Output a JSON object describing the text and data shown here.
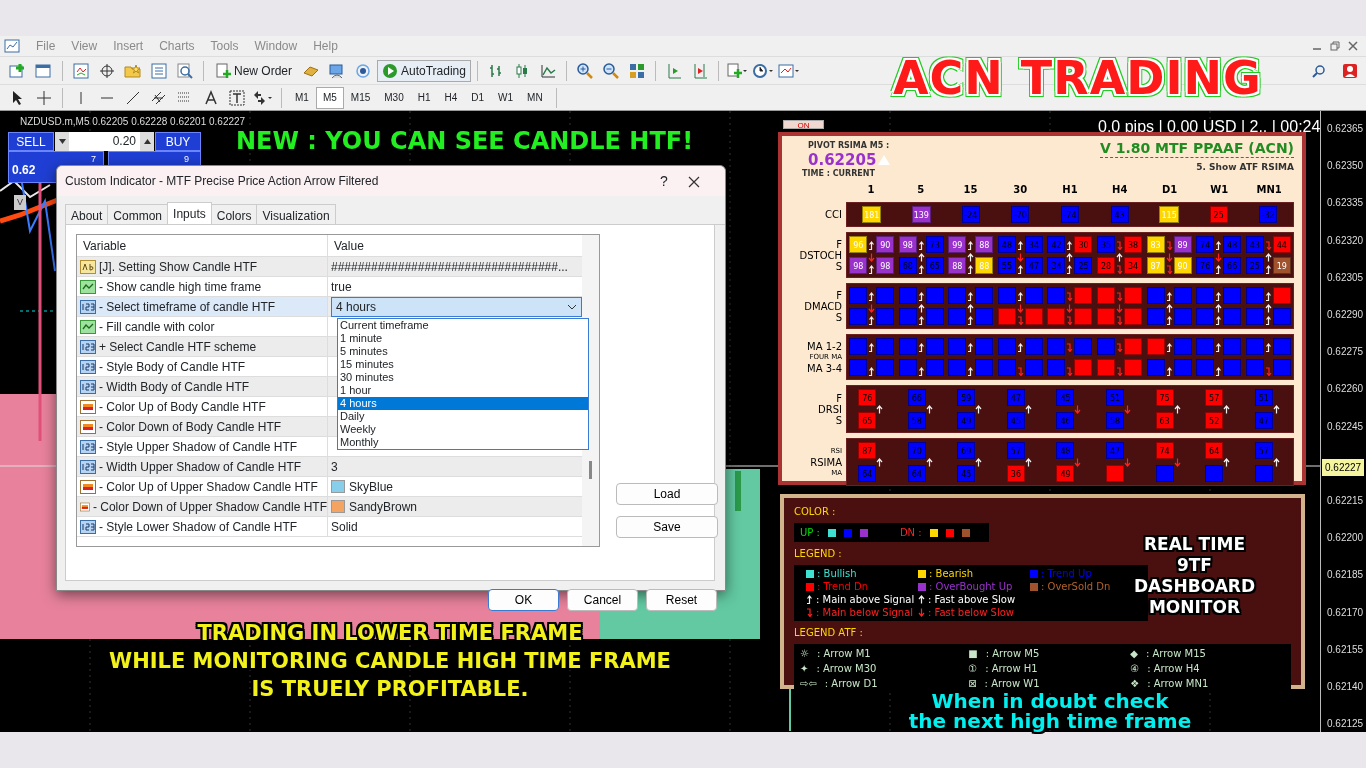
{
  "menu": [
    {
      "label": "File"
    },
    {
      "label": "View"
    },
    {
      "label": "Insert"
    },
    {
      "label": "Charts"
    },
    {
      "label": "Tools"
    },
    {
      "label": "Window"
    },
    {
      "label": "Help"
    }
  ],
  "toolbar": {
    "new_order": "New Order",
    "auto_trading": "AutoTrading"
  },
  "timeframes": [
    {
      "label": "M1",
      "selected": false
    },
    {
      "label": "M5",
      "selected": true
    },
    {
      "label": "M15",
      "selected": false
    },
    {
      "label": "M30",
      "selected": false
    },
    {
      "label": "H1",
      "selected": false
    },
    {
      "label": "H4",
      "selected": false
    },
    {
      "label": "D1",
      "selected": false
    },
    {
      "label": "W1",
      "selected": false
    },
    {
      "label": "MN",
      "selected": false
    }
  ],
  "logo": "ACN TRADING",
  "chart": {
    "symbol": "NZDUSD.m,M5  0.62205 0.62228 0.62201 0.62227",
    "on_button": "ON",
    "status": "0.0 pips | 0.00 USD | 2.. | 00:24",
    "current_price": "0.62227",
    "price_axis": [
      "0.62365",
      "0.62350",
      "0.62335",
      "0.62320",
      "0.62305",
      "0.62290",
      "0.62275",
      "0.62260",
      "0.62245",
      "0.62215",
      "0.62200",
      "0.62185",
      "0.62170",
      "0.62155",
      "0.62140",
      "0.62125"
    ]
  },
  "trade_panel": {
    "sell": "SELL",
    "lot": "0.20",
    "buy": "BUY",
    "sell_price": "0.62",
    "sell_digit": "7",
    "buy_digit": "9",
    "marker": "V"
  },
  "banners": [
    {
      "lines": [
        "NEW : YOU CAN SEE CANDLE HTF!"
      ],
      "color": "#22ee22"
    },
    {
      "lines": [
        "TRADING IN LOWER TIME FRAME",
        "WHILE MONITORING CANDLE HIGH TIME FRAME",
        "IS TRUELY PROFITABLE."
      ],
      "color": "#f2f21a"
    },
    {
      "lines": [
        "When in doubt check",
        "the next high time frame"
      ],
      "color": "#00f0f0"
    }
  ],
  "dialog": {
    "title": "Custom Indicator - MTF Precise Price Action Arrow Filtered",
    "help": "?",
    "tabs": [
      {
        "label": "About",
        "selected": false
      },
      {
        "label": "Common",
        "selected": false
      },
      {
        "label": "Inputs",
        "selected": true
      },
      {
        "label": "Colors",
        "selected": false
      },
      {
        "label": "Visualization",
        "selected": false
      }
    ],
    "columns": [
      "Variable",
      "Value"
    ],
    "rows": [
      {
        "kind": "string",
        "name": "[J]. Setting Show Candle HTF",
        "value": "##################################...",
        "selected": false
      },
      {
        "kind": "bool",
        "name": "- Show candle high time frame",
        "value": "true",
        "selected": false
      },
      {
        "kind": "int",
        "name": "- Select timeframe of candle HTF",
        "value": "4 hours",
        "selected": true
      },
      {
        "kind": "bool",
        "name": "- Fill candle with color",
        "selected": false
      },
      {
        "kind": "int",
        "name": "+ Select Candle HTF scheme",
        "selected": false
      },
      {
        "kind": "int",
        "name": "- Style Body of Candle HTF",
        "selected": false
      },
      {
        "kind": "int",
        "name": "- Width Body of Candle HTF",
        "selected": false
      },
      {
        "kind": "color",
        "name": "- Color Up of Body Candle HTF",
        "selected": false
      },
      {
        "kind": "color",
        "name": "- Color Down of Body Candle HTF",
        "selected": false
      },
      {
        "kind": "int",
        "name": "- Style Upper Shadow of Candle HTF",
        "selected": false
      },
      {
        "kind": "int",
        "name": "- Width Upper Shadow of Candle HTF",
        "value": "3",
        "selected": false
      },
      {
        "kind": "color",
        "name": "- Color Up of Upper Shadow Candle HTF",
        "value": "SkyBlue",
        "color": "#87ceeb",
        "selected": false
      },
      {
        "kind": "color",
        "name": "- Color Down of Upper Shadow Candle HTF",
        "value": "SandyBrown",
        "color": "#f4a460",
        "selected": false
      },
      {
        "kind": "int",
        "name": "- Style Lower Shadow of Candle HTF",
        "value": "Solid",
        "selected": false
      }
    ],
    "options": [
      {
        "label": "Current timeframe",
        "selected": false
      },
      {
        "label": "1 minute",
        "selected": false
      },
      {
        "label": "5 minutes",
        "selected": false
      },
      {
        "label": "15 minutes",
        "selected": false
      },
      {
        "label": "30 minutes",
        "selected": false
      },
      {
        "label": "1 hour",
        "selected": false
      },
      {
        "label": "4 hours",
        "selected": true
      },
      {
        "label": "Daily",
        "selected": false
      },
      {
        "label": "Weekly",
        "selected": false
      },
      {
        "label": "Monthly",
        "selected": false
      }
    ],
    "side_buttons": [
      "Load",
      "Save"
    ],
    "buttons": [
      "OK",
      "Cancel",
      "Reset"
    ]
  },
  "dashboard": {
    "pivot_label": "PIVOT RSIMA M5 :",
    "pivot_value": "0.62205",
    "pivot_rising": true,
    "time_label": "TIME : CURRENT",
    "title": "V 1.80 MTF PPAAF (ACN)",
    "subtitle": "5. Show ATF RSIMA",
    "timeframes": [
      "1",
      "5",
      "15",
      "30",
      "H1",
      "H4",
      "D1",
      "W1",
      "MN1"
    ],
    "rows": [
      {
        "kind": "single",
        "labels": [
          "CCI"
        ],
        "cells": [
          {
            "v": "181",
            "color": "#ffd700"
          },
          {
            "v": "139",
            "color": "#9932cc"
          },
          {
            "v": "-24",
            "color": "#0000ff"
          },
          {
            "v": "-70",
            "color": "#0000ff"
          },
          {
            "v": "-74",
            "color": "#0000ff"
          },
          {
            "v": "43",
            "color": "#0000ff"
          },
          {
            "v": "115",
            "color": "#ffd700"
          },
          {
            "v": "25",
            "color": "#ff0000"
          },
          {
            "v": "-32",
            "color": "#0000ff"
          }
        ]
      },
      {
        "kind": "pair",
        "labels": [
          "F",
          "DSTOCH",
          "S"
        ],
        "groups": [
          {
            "f": [
              {
                "v": "96",
                "color": "#ffd700"
              },
              {
                "v": "90",
                "color": "#9932cc"
              }
            ],
            "s": [
              {
                "v": "98",
                "color": "#9932cc"
              },
              {
                "v": "98",
                "color": "#9932cc"
              }
            ],
            "f_above": true,
            "s_above": true,
            "rising": false
          },
          {
            "f": [
              {
                "v": "98",
                "color": "#9932cc"
              },
              {
                "v": "73",
                "color": "#0000ff"
              }
            ],
            "s": [
              {
                "v": "68",
                "color": "#0000ff"
              },
              {
                "v": "65",
                "color": "#0000ff"
              }
            ],
            "f_above": true,
            "s_above": true,
            "rising": true
          },
          {
            "f": [
              {
                "v": "99",
                "color": "#9932cc"
              },
              {
                "v": "88",
                "color": "#9932cc"
              }
            ],
            "s": [
              {
                "v": "88",
                "color": "#9932cc"
              },
              {
                "v": "88",
                "color": "#ffd700"
              }
            ],
            "f_above": true,
            "s_above": true,
            "rising": true
          },
          {
            "f": [
              {
                "v": "48",
                "color": "#0000ff"
              },
              {
                "v": "34",
                "color": "#0000ff"
              }
            ],
            "s": [
              {
                "v": "55",
                "color": "#0000ff"
              },
              {
                "v": "47",
                "color": "#0000ff"
              }
            ],
            "f_above": true,
            "s_above": true,
            "rising": false
          },
          {
            "f": [
              {
                "v": "42",
                "color": "#0000ff"
              },
              {
                "v": "30",
                "color": "#ff0000"
              }
            ],
            "s": [
              {
                "v": "34",
                "color": "#0000ff"
              },
              {
                "v": "25",
                "color": "#0000ff"
              }
            ],
            "f_above": true,
            "s_above": true,
            "rising": true
          },
          {
            "f": [
              {
                "v": "35",
                "color": "#0000ff"
              },
              {
                "v": "38",
                "color": "#ff0000"
              }
            ],
            "s": [
              {
                "v": "28",
                "color": "#ff0000"
              },
              {
                "v": "34",
                "color": "#ff0000"
              }
            ],
            "f_above": false,
            "s_above": false,
            "rising": true
          },
          {
            "f": [
              {
                "v": "83",
                "color": "#ffd700"
              },
              {
                "v": "89",
                "color": "#9932cc"
              }
            ],
            "s": [
              {
                "v": "87",
                "color": "#ffd700"
              },
              {
                "v": "90",
                "color": "#ffd700"
              }
            ],
            "f_above": false,
            "s_above": false,
            "rising": false
          },
          {
            "f": [
              {
                "v": "74",
                "color": "#0000ff"
              },
              {
                "v": "48",
                "color": "#0000ff"
              }
            ],
            "s": [
              {
                "v": "76",
                "color": "#0000ff"
              },
              {
                "v": "66",
                "color": "#0000ff"
              }
            ],
            "f_above": true,
            "s_above": true,
            "rising": false
          },
          {
            "f": [
              {
                "v": "43",
                "color": "#0000ff"
              },
              {
                "v": "44",
                "color": "#ff0000"
              }
            ],
            "s": [
              {
                "v": "25",
                "color": "#0000ff"
              },
              {
                "v": "19",
                "color": "#a0522d"
              }
            ],
            "f_above": false,
            "s_above": true,
            "rising": true
          }
        ]
      },
      {
        "kind": "pair",
        "labels": [
          "F",
          "DMACD",
          "S"
        ],
        "groups": [
          {
            "f": [
              {
                "color": "#0000ff"
              },
              {
                "color": "#0000ff"
              }
            ],
            "s": [
              {
                "color": "#0000ff"
              },
              {
                "color": "#0000ff"
              }
            ],
            "f_above": true,
            "s_above": true,
            "rising": false
          },
          {
            "f": [
              {
                "color": "#0000ff"
              },
              {
                "color": "#0000ff"
              }
            ],
            "s": [
              {
                "color": "#0000ff"
              },
              {
                "color": "#0000ff"
              }
            ],
            "f_above": true,
            "s_above": true,
            "rising": true
          },
          {
            "f": [
              {
                "color": "#0000ff"
              },
              {
                "color": "#0000ff"
              }
            ],
            "s": [
              {
                "color": "#0000ff"
              },
              {
                "color": "#0000ff"
              }
            ],
            "f_above": true,
            "s_above": true,
            "rising": true
          },
          {
            "f": [
              {
                "color": "#0000ff"
              },
              {
                "color": "#0000ff"
              }
            ],
            "s": [
              {
                "color": "#ff0000"
              },
              {
                "color": "#ff0000"
              }
            ],
            "f_above": true,
            "s_above": false,
            "rising": false
          },
          {
            "f": [
              {
                "color": "#0000ff"
              },
              {
                "color": "#ff0000"
              }
            ],
            "s": [
              {
                "color": "#ff0000"
              },
              {
                "color": "#ff0000"
              }
            ],
            "f_above": false,
            "s_above": false,
            "rising": false
          },
          {
            "f": [
              {
                "color": "#ff0000"
              },
              {
                "color": "#ff0000"
              }
            ],
            "s": [
              {
                "color": "#ff0000"
              },
              {
                "color": "#ff0000"
              }
            ],
            "f_above": false,
            "s_above": false,
            "rising": false
          },
          {
            "f": [
              {
                "color": "#0000ff"
              },
              {
                "color": "#0000ff"
              }
            ],
            "s": [
              {
                "color": "#0000ff"
              },
              {
                "color": "#0000ff"
              }
            ],
            "f_above": true,
            "s_above": true,
            "rising": true
          },
          {
            "f": [
              {
                "color": "#0000ff"
              },
              {
                "color": "#0000ff"
              }
            ],
            "s": [
              {
                "color": "#0000ff"
              },
              {
                "color": "#0000ff"
              }
            ],
            "f_above": true,
            "s_above": true,
            "rising": true
          },
          {
            "f": [
              {
                "color": "#0000ff"
              },
              {
                "color": "#ff0000"
              }
            ],
            "s": [
              {
                "color": "#0000ff"
              },
              {
                "color": "#0000ff"
              }
            ],
            "f_above": true,
            "s_above": true,
            "rising": true
          }
        ]
      },
      {
        "kind": "pair",
        "labels": [
          "MA 1-2",
          "FOUR MA",
          "MA 3-4"
        ],
        "groups": [
          {
            "f": [
              {
                "color": "#0000ff"
              },
              {
                "color": "#0000ff"
              }
            ],
            "s": [
              {
                "color": "#0000ff"
              },
              {
                "color": "#0000ff"
              }
            ],
            "f_above": true,
            "s_above": true
          },
          {
            "f": [
              {
                "color": "#0000ff"
              },
              {
                "color": "#0000ff"
              }
            ],
            "s": [
              {
                "color": "#0000ff"
              },
              {
                "color": "#0000ff"
              }
            ],
            "f_above": true,
            "s_above": true
          },
          {
            "f": [
              {
                "color": "#0000ff"
              },
              {
                "color": "#0000ff"
              }
            ],
            "s": [
              {
                "color": "#0000ff"
              },
              {
                "color": "#0000ff"
              }
            ],
            "f_above": true,
            "s_above": true
          },
          {
            "f": [
              {
                "color": "#0000ff"
              },
              {
                "color": "#0000ff"
              }
            ],
            "s": [
              {
                "color": "#0000ff"
              },
              {
                "color": "#0000ff"
              }
            ],
            "f_above": true,
            "s_above": false
          },
          {
            "f": [
              {
                "color": "#0000ff"
              },
              {
                "color": "#0000ff"
              }
            ],
            "s": [
              {
                "color": "#0000ff"
              },
              {
                "color": "#ff0000"
              }
            ],
            "f_above": false,
            "s_above": false
          },
          {
            "f": [
              {
                "color": "#0000ff"
              },
              {
                "color": "#ff0000"
              }
            ],
            "s": [
              {
                "color": "#ff0000"
              },
              {
                "color": "#ff0000"
              }
            ],
            "f_above": false,
            "s_above": false
          },
          {
            "f": [
              {
                "color": "#ff0000"
              },
              {
                "color": "#0000ff"
              }
            ],
            "s": [
              {
                "color": "#0000ff"
              },
              {
                "color": "#0000ff"
              }
            ],
            "f_above": true,
            "s_above": true
          },
          {
            "f": [
              {
                "color": "#0000ff"
              },
              {
                "color": "#0000ff"
              }
            ],
            "s": [
              {
                "color": "#0000ff"
              },
              {
                "color": "#0000ff"
              }
            ],
            "f_above": true,
            "s_above": true
          },
          {
            "f": [
              {
                "color": "#0000ff"
              },
              {
                "color": "#0000ff"
              }
            ],
            "s": [
              {
                "color": "#0000ff"
              },
              {
                "color": "#0000ff"
              }
            ],
            "f_above": true,
            "s_above": false
          }
        ]
      },
      {
        "kind": "stack",
        "labels": [
          "F",
          "DRSI",
          "S"
        ],
        "groups": [
          {
            "top": {
              "v": "76",
              "color": "#ff0000"
            },
            "bottom": {
              "v": "65",
              "color": "#ff0000"
            },
            "rising": true
          },
          {
            "top": {
              "v": "66",
              "color": "#0000ff"
            },
            "bottom": {
              "v": "58",
              "color": "#0000ff"
            },
            "rising": true
          },
          {
            "top": {
              "v": "59",
              "color": "#0000ff"
            },
            "bottom": {
              "v": "49",
              "color": "#0000ff"
            },
            "rising": true
          },
          {
            "top": {
              "v": "47",
              "color": "#0000ff"
            },
            "bottom": {
              "v": "45",
              "color": "#0000ff"
            },
            "rising": true
          },
          {
            "top": {
              "v": "45",
              "color": "#0000ff"
            },
            "bottom": {
              "v": "46",
              "color": "#0000ff"
            },
            "rising": false
          },
          {
            "top": {
              "v": "51",
              "color": "#0000ff"
            },
            "bottom": {
              "v": "58",
              "color": "#0000ff"
            },
            "rising": false
          },
          {
            "top": {
              "v": "75",
              "color": "#ff0000"
            },
            "bottom": {
              "v": "63",
              "color": "#ff0000"
            },
            "rising": true
          },
          {
            "top": {
              "v": "57",
              "color": "#ff0000"
            },
            "bottom": {
              "v": "52",
              "color": "#ff0000"
            },
            "rising": true
          },
          {
            "top": {
              "v": "51",
              "color": "#0000ff"
            },
            "bottom": {
              "v": "47",
              "color": "#0000ff"
            },
            "rising": true
          }
        ]
      },
      {
        "kind": "stack",
        "labels": [
          "RSI",
          "RSIMA",
          "MA"
        ],
        "groups": [
          {
            "top": {
              "v": "87",
              "color": "#ff0000"
            },
            "bottom": {
              "v": "64",
              "color": "#0000ff"
            },
            "rising": true
          },
          {
            "top": {
              "v": "70",
              "color": "#0000ff"
            },
            "bottom": {
              "v": "64",
              "color": "#0000ff"
            },
            "rising": true
          },
          {
            "top": {
              "v": "69",
              "color": "#0000ff"
            },
            "bottom": {
              "v": "45",
              "color": "#0000ff"
            },
            "rising": true
          },
          {
            "top": {
              "v": "57",
              "color": "#0000ff"
            },
            "bottom": {
              "v": "36",
              "color": "#ff0000"
            },
            "rising": true
          },
          {
            "top": {
              "v": "48",
              "color": "#0000ff"
            },
            "bottom": {
              "v": "49",
              "color": "#ff0000"
            },
            "rising": false
          },
          {
            "top": {
              "v": "47",
              "color": "#0000ff"
            },
            "bottom": {
              "color": "#ff0000"
            },
            "rising": false
          },
          {
            "top": {
              "v": "74",
              "color": "#ff0000"
            },
            "bottom": {
              "color": "#0000ff"
            },
            "rising": false
          },
          {
            "top": {
              "v": "64",
              "color": "#ff0000"
            },
            "bottom": {
              "color": "#0000ff"
            },
            "rising": true
          },
          {
            "top": {
              "v": "57",
              "color": "#0000ff"
            },
            "bottom": {
              "color": "#0000ff"
            },
            "rising": true
          }
        ]
      }
    ]
  },
  "legend": {
    "color_title": "COLOR :",
    "up_label": "UP :",
    "up_colors": [
      {
        "color": "#40e0d0"
      },
      {
        "color": "#0000ff"
      },
      {
        "color": "#9932cc"
      }
    ],
    "dn_label": "DN :",
    "dn_colors": [
      {
        "color": "#ffd700"
      },
      {
        "color": "#ff0000"
      },
      {
        "color": "#a0522d"
      }
    ],
    "legend_title": "LEGEND :",
    "items": [
      {
        "kind": "swatch",
        "color": "#40e0d0",
        "text": ": Bullish"
      },
      {
        "kind": "swatch",
        "color": "#ffd700",
        "text": ": Bearish"
      },
      {
        "kind": "swatch",
        "color": "#0000ff",
        "text": ": Trend Up"
      },
      {
        "kind": "swatch",
        "color": "#ff0000",
        "text": ": Trend Dn"
      },
      {
        "kind": "swatch",
        "color": "#9932cc",
        "text": ": OverBought Up"
      },
      {
        "kind": "swatch",
        "color": "#a0522d",
        "text": ": OverSold Dn"
      },
      {
        "kind": "hook_up",
        "text": ": Main above Signal"
      },
      {
        "kind": "arrow_up",
        "text": ": Fast above Slow"
      },
      {
        "kind": "hook_down",
        "text": ": Main below Signal"
      },
      {
        "kind": "arrow_down",
        "text": ": Fast below Slow"
      }
    ],
    "atf_title": "LEGEND ATF :",
    "atf_items": [
      {
        "icon": "☼",
        "text": ": Arrow M1"
      },
      {
        "icon": "■",
        "text": ": Arrow M5"
      },
      {
        "icon": "◆",
        "text": ": Arrow M15"
      },
      {
        "icon": "✦",
        "text": ": Arrow M30"
      },
      {
        "icon": "①",
        "text": ": Arrow H1"
      },
      {
        "icon": "④",
        "text": ": Arrow H4"
      },
      {
        "icon": "⇨⇦",
        "text": ": Arrow D1"
      },
      {
        "icon": "⊠",
        "text": ": Arrow W1"
      },
      {
        "icon": "❖",
        "text": ": Arrow MN1"
      }
    ],
    "banner": [
      "REAL TIME",
      "9TF",
      "DASHBOARD",
      "MONITOR"
    ]
  }
}
